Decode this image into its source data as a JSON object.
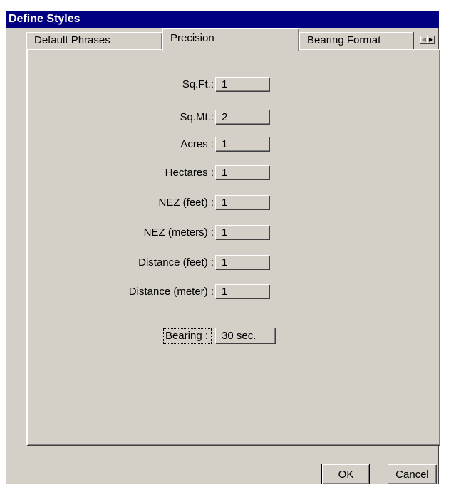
{
  "window": {
    "title": "Define Styles"
  },
  "tabs": [
    {
      "label": "Default Phrases"
    },
    {
      "label": "Precision"
    },
    {
      "label": "Bearing Format"
    }
  ],
  "precision_rows": [
    {
      "label": "Sq.Ft.:",
      "value": "1"
    },
    {
      "label": "Sq.Mt.:",
      "value": "2"
    },
    {
      "label": "Acres :",
      "value": "1"
    },
    {
      "label": "Hectares :",
      "value": "1"
    },
    {
      "label": "NEZ (feet) :",
      "value": "1"
    },
    {
      "label": "NEZ (meters) :",
      "value": "1"
    },
    {
      "label": "Distance (feet) :",
      "value": "1"
    },
    {
      "label": "Distance (meter) :",
      "value": "1"
    }
  ],
  "bearing": {
    "label": "Bearing :",
    "value": "30  sec."
  },
  "buttons": {
    "ok_mnemonic": "O",
    "ok_rest": "K",
    "cancel": "Cancel"
  },
  "icons": {
    "tab_scroll_left": "arrow-left-icon",
    "tab_scroll_right": "arrow-right-icon"
  }
}
